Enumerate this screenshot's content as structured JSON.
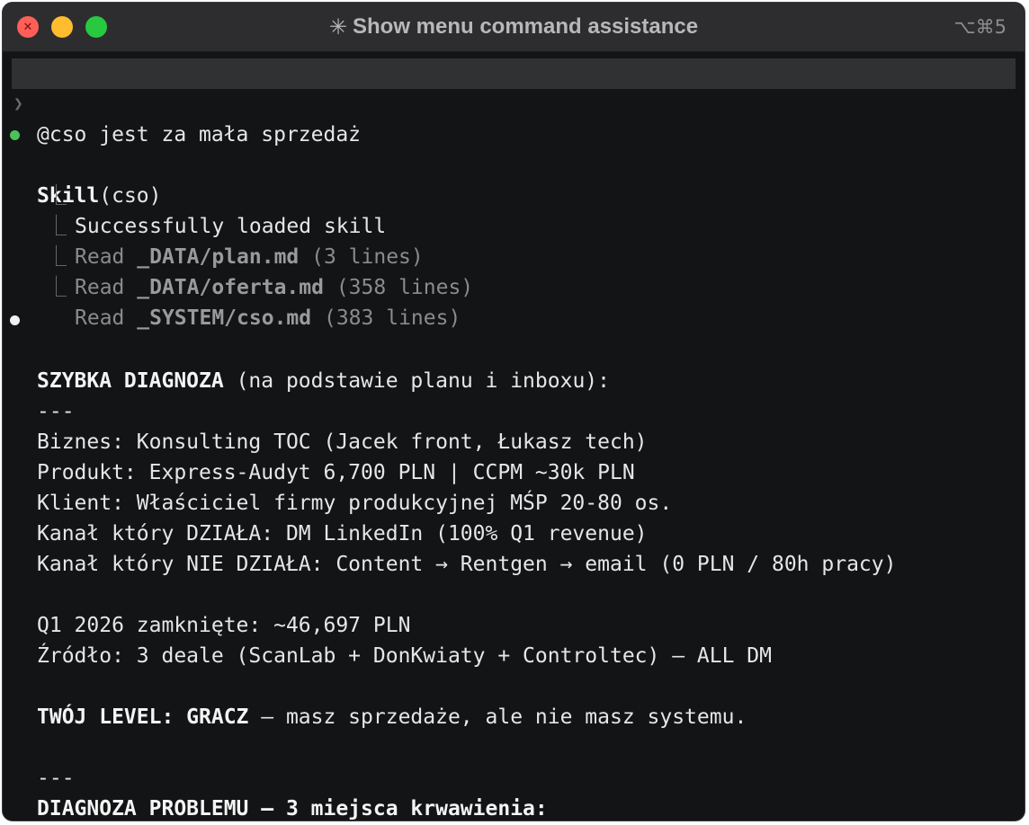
{
  "window": {
    "title": "Show menu command assistance",
    "title_icon": "✳",
    "shortcut": "⌥⌘5"
  },
  "prompt": {
    "chevron": "❯",
    "text": "@cso jest za mała sprzedaż"
  },
  "skill": {
    "name": "Skill",
    "arg": "(cso)",
    "loaded": "Successfully loaded skill",
    "reads": [
      {
        "verb": "Read",
        "path": "_DATA/plan.md",
        "count": "(3 lines)"
      },
      {
        "verb": "Read",
        "path": "_DATA/oferta.md",
        "count": "(358 lines)"
      },
      {
        "verb": "Read",
        "path": "_SYSTEM/cso.md",
        "count": "(383 lines)"
      }
    ]
  },
  "response": {
    "heading": "SZYBKA DIAGNOZA",
    "heading_rest": " (na podstawie planu i inboxu):",
    "sep1": "---",
    "biznes": "Biznes: Konsulting TOC (Jacek front, Łukasz tech)",
    "produkt": "Produkt: Express-Audyt 6,700 PLN | CCPM ~30k PLN",
    "klient": "Klient: Właściciel firmy produkcyjnej MŚP 20-80 os.",
    "kanal_dziala": "Kanał który DZIAŁA: DM LinkedIn (100% Q1 revenue)",
    "kanal_nie": "Kanał który NIE DZIAŁA: Content → Rentgen → email (0 PLN / 80h pracy)",
    "q1": "Q1 2026 zamknięte: ~46,697 PLN",
    "zrodlo": "Źródło: 3 deale (ScanLab + DonKwiaty + Controltec) — ALL DM",
    "level_label": "TWÓJ LEVEL: GRACZ",
    "level_rest": " — masz sprzedaże, ale nie masz systemu.",
    "sep2": "---",
    "problem_heading": "DIAGNOZA PROBLEMU — 3 miejsca krwawienia:"
  }
}
